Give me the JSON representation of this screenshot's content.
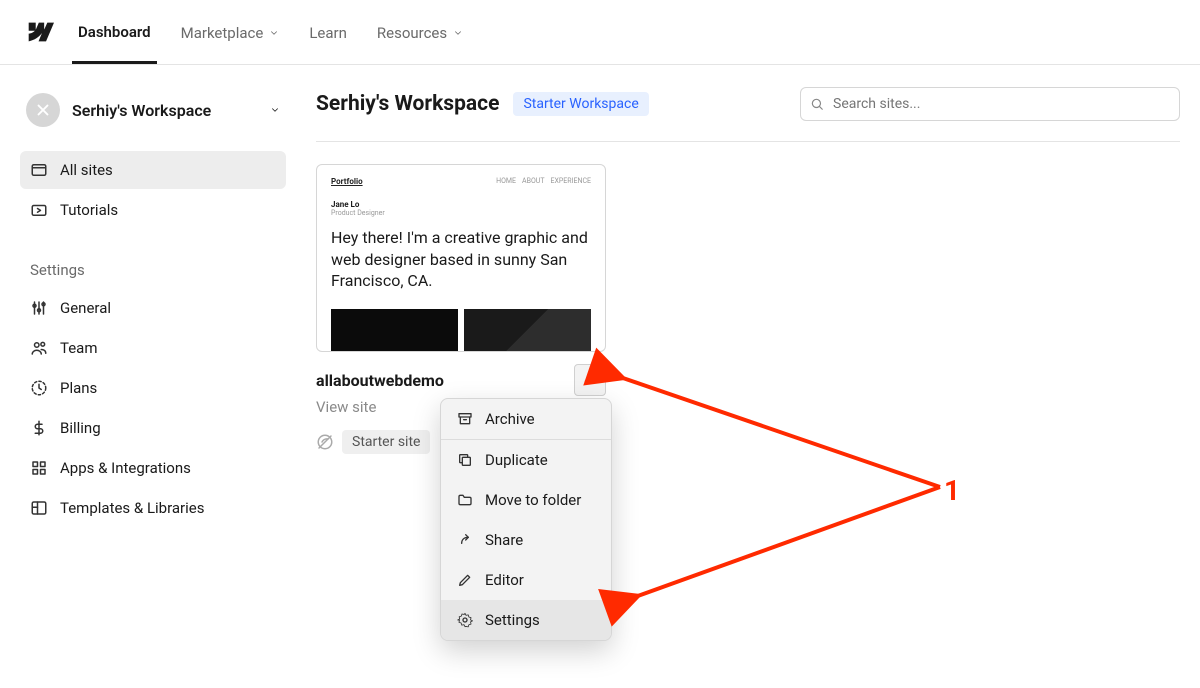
{
  "topnav": {
    "items": [
      "Dashboard",
      "Marketplace",
      "Learn",
      "Resources"
    ]
  },
  "sidebar": {
    "workspace_name": "Serhiy's Workspace",
    "nav": [
      {
        "label": "All sites"
      },
      {
        "label": "Tutorials"
      }
    ],
    "settings_title": "Settings",
    "settings": [
      {
        "label": "General"
      },
      {
        "label": "Team"
      },
      {
        "label": "Plans"
      },
      {
        "label": "Billing"
      },
      {
        "label": "Apps & Integrations"
      },
      {
        "label": "Templates & Libraries"
      }
    ]
  },
  "main": {
    "title": "Serhiy's Workspace",
    "badge": "Starter Workspace",
    "search_placeholder": "Search sites..."
  },
  "site": {
    "name": "allaboutwebdemo",
    "view": "View site",
    "starter": "Starter site",
    "thumb": {
      "brand": "Portfolio",
      "menu": [
        "HOME",
        "ABOUT",
        "EXPERIENCE"
      ],
      "person": "Jane Lo",
      "role": "Product Designer",
      "hero": "Hey there! I'm a creative graphic and web designer based in sunny San Francisco, CA."
    }
  },
  "dropdown": {
    "items": [
      "Archive",
      "Duplicate",
      "Move to folder",
      "Share",
      "Editor",
      "Settings"
    ]
  },
  "annotation": {
    "num": "1"
  }
}
